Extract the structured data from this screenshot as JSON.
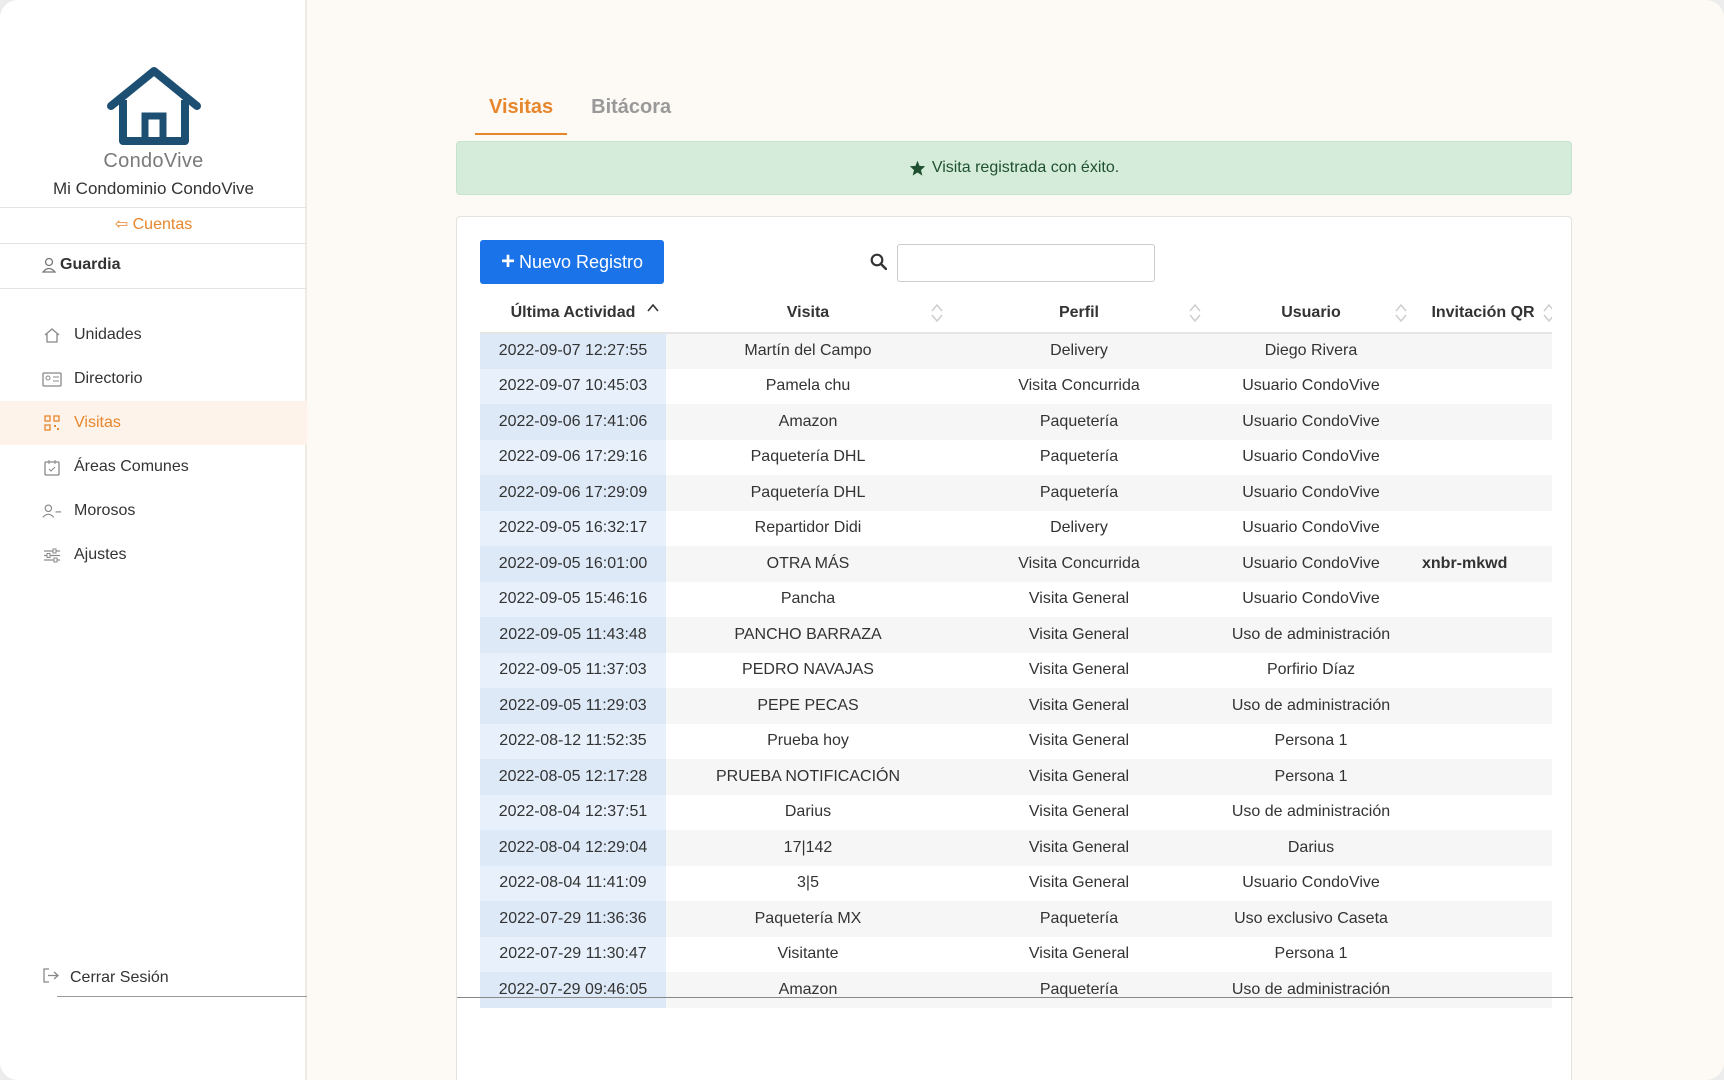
{
  "sidebar": {
    "brand": "CondoVive",
    "condo": "Mi Condominio CondoVive",
    "accounts_label": "Cuentas",
    "role": "Guardia",
    "items": [
      {
        "label": "Unidades",
        "icon": "home-icon"
      },
      {
        "label": "Directorio",
        "icon": "id-card-icon"
      },
      {
        "label": "Visitas",
        "icon": "qr-code-icon",
        "active": true
      },
      {
        "label": "Áreas Comunes",
        "icon": "calendar-icon"
      },
      {
        "label": "Morosos",
        "icon": "user-minus-icon"
      },
      {
        "label": "Ajustes",
        "icon": "sliders-icon"
      }
    ],
    "logout": "Cerrar Sesión"
  },
  "tabs": [
    "Visitas",
    "Bitácora"
  ],
  "alert": "Visita registrada con éxito.",
  "toolbar": {
    "new_label": "Nuevo Registro",
    "search_placeholder": ""
  },
  "table": {
    "columns": [
      "Última Actividad",
      "Visita",
      "Perfil",
      "Usuario",
      "Invitación QR"
    ],
    "rows": [
      [
        "2022-09-07 12:27:55",
        "Martín del Campo",
        "Delivery",
        "Diego Rivera",
        ""
      ],
      [
        "2022-09-07 10:45:03",
        "Pamela chu",
        "Visita Concurrida",
        "Usuario CondoVive",
        ""
      ],
      [
        "2022-09-06 17:41:06",
        "Amazon",
        "Paquetería",
        "Usuario CondoVive",
        ""
      ],
      [
        "2022-09-06 17:29:16",
        "Paquetería DHL",
        "Paquetería",
        "Usuario CondoVive",
        ""
      ],
      [
        "2022-09-06 17:29:09",
        "Paquetería DHL",
        "Paquetería",
        "Usuario CondoVive",
        ""
      ],
      [
        "2022-09-05 16:32:17",
        "Repartidor Didi",
        "Delivery",
        "Usuario CondoVive",
        ""
      ],
      [
        "2022-09-05 16:01:00",
        "OTRA MÁS",
        "Visita Concurrida",
        "Usuario CondoVive",
        "xnbr-mkwd"
      ],
      [
        "2022-09-05 15:46:16",
        "Pancha",
        "Visita General",
        "Usuario CondoVive",
        ""
      ],
      [
        "2022-09-05 11:43:48",
        "PANCHO BARRAZA",
        "Visita General",
        "Uso de administración",
        ""
      ],
      [
        "2022-09-05 11:37:03",
        "PEDRO NAVAJAS",
        "Visita General",
        "Porfirio Díaz",
        ""
      ],
      [
        "2022-09-05 11:29:03",
        "PEPE PECAS",
        "Visita General",
        "Uso de administración",
        ""
      ],
      [
        "2022-08-12 11:52:35",
        "Prueba hoy",
        "Visita General",
        "Persona 1",
        ""
      ],
      [
        "2022-08-05 12:17:28",
        "PRUEBA NOTIFICACIÓN",
        "Visita General",
        "Persona 1",
        ""
      ],
      [
        "2022-08-04 12:37:51",
        "Darius",
        "Visita General",
        "Uso de administración",
        ""
      ],
      [
        "2022-08-04 12:29:04",
        "17|142",
        "Visita General",
        "Darius",
        ""
      ],
      [
        "2022-08-04 11:41:09",
        "3|5",
        "Visita General",
        "Usuario CondoVive",
        ""
      ],
      [
        "2022-07-29 11:36:36",
        "Paquetería MX",
        "Paquetería",
        "Uso exclusivo Caseta",
        ""
      ],
      [
        "2022-07-29 11:30:47",
        "Visitante",
        "Visita General",
        "Persona 1",
        ""
      ],
      [
        "2022-07-29 09:46:05",
        "Amazon",
        "Paquetería",
        "Uso de administración",
        ""
      ]
    ]
  },
  "colors": {
    "accent": "#e8862c",
    "primary": "#1a73e8",
    "success_bg": "#d4ecd9",
    "logo": "#1d4f73"
  }
}
